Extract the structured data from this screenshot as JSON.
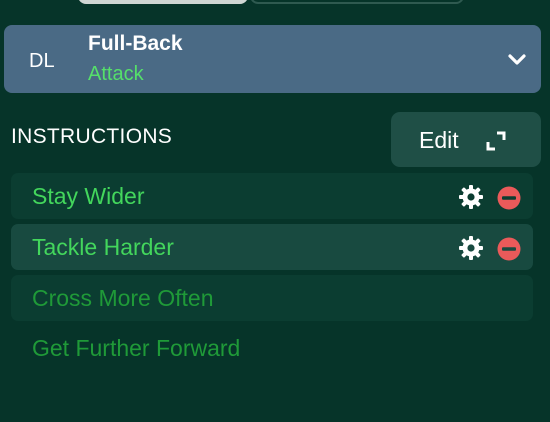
{
  "role": {
    "position": "DL",
    "name": "Full-Back",
    "duty": "Attack"
  },
  "instructions": {
    "heading": "INSTRUCTIONS",
    "edit_label": "Edit",
    "items": [
      {
        "label": "Stay Wider",
        "active": true
      },
      {
        "label": "Tackle Harder",
        "active": true
      },
      {
        "label": "Cross More Often",
        "active": false
      },
      {
        "label": "Get Further Forward",
        "active": false
      }
    ]
  },
  "icons": {
    "role_chevron": "chevron-down-icon",
    "edit": "expand-icon",
    "settings": "gear-icon",
    "remove": "remove-icon"
  },
  "colors": {
    "background": "#063429",
    "role_card": "#4a6a85",
    "duty_text": "#55e06a",
    "active_instruction": "#43d65c",
    "inactive_instruction": "#1f9a38",
    "remove_icon": "#ea5a5a"
  }
}
